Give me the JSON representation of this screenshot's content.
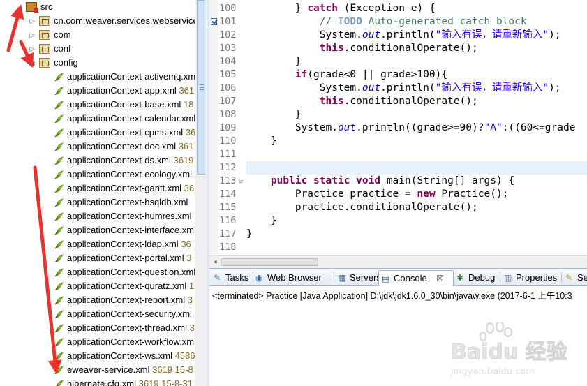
{
  "tree": {
    "root": {
      "label": "src",
      "icon": "source-folder-icon"
    },
    "items": [
      {
        "label": "cn.com.weaver.services.webservice",
        "meta": "",
        "kind": "package",
        "expanded": false
      },
      {
        "label": "com",
        "meta": "",
        "kind": "package",
        "expanded": false
      },
      {
        "label": "conf",
        "meta": "",
        "kind": "package",
        "expanded": false
      },
      {
        "label": "config",
        "meta": "",
        "kind": "package",
        "expanded": true
      }
    ],
    "files": [
      {
        "label": "applicationContext-activemq.xml",
        "meta": ""
      },
      {
        "label": "applicationContext-app.xml",
        "meta": "361"
      },
      {
        "label": "applicationContext-base.xml",
        "meta": "18"
      },
      {
        "label": "applicationContext-calendar.xml",
        "meta": ""
      },
      {
        "label": "applicationContext-cpms.xml",
        "meta": "36"
      },
      {
        "label": "applicationContext-doc.xml",
        "meta": "361"
      },
      {
        "label": "applicationContext-ds.xml",
        "meta": "3619"
      },
      {
        "label": "applicationContext-ecology.xml",
        "meta": ""
      },
      {
        "label": "applicationContext-gantt.xml",
        "meta": "36"
      },
      {
        "label": "applicationContext-hsqldb.xml",
        "meta": ""
      },
      {
        "label": "applicationContext-humres.xml",
        "meta": ""
      },
      {
        "label": "applicationContext-interface.xml",
        "meta": ""
      },
      {
        "label": "applicationContext-ldap.xml",
        "meta": "36"
      },
      {
        "label": "applicationContext-portal.xml",
        "meta": "3"
      },
      {
        "label": "applicationContext-question.xml",
        "meta": ""
      },
      {
        "label": "applicationContext-quratz.xml",
        "meta": "1"
      },
      {
        "label": "applicationContext-report.xml",
        "meta": "3"
      },
      {
        "label": "applicationContext-security.xml",
        "meta": ""
      },
      {
        "label": "applicationContext-thread.xml",
        "meta": "3"
      },
      {
        "label": "applicationContext-workflow.xml",
        "meta": ""
      },
      {
        "label": "applicationContext-ws.xml",
        "meta": "4586"
      },
      {
        "label": "eweaver-service.xml",
        "meta": "3619  15-8"
      },
      {
        "label": "hibernate.cfg.xml",
        "meta": "3619  15-8-31"
      }
    ]
  },
  "editor": {
    "lines": [
      {
        "num": "100",
        "code": "        } catch (Exception e) {"
      },
      {
        "num": "101",
        "code": "            // TODO Auto-generated catch block"
      },
      {
        "num": "102",
        "code": "            System.out.println(\"输入有误，请重新输入\");"
      },
      {
        "num": "103",
        "code": "            this.conditionalOperate();"
      },
      {
        "num": "104",
        "code": "        }"
      },
      {
        "num": "105",
        "code": "        if(grade<0 || grade>100){"
      },
      {
        "num": "106",
        "code": "            System.out.println(\"输入有误，请重新输入\");"
      },
      {
        "num": "107",
        "code": "            this.conditionalOperate();"
      },
      {
        "num": "108",
        "code": "        }"
      },
      {
        "num": "109",
        "code": "        System.out.println((grade>=90)?\"A\":((60<=grade"
      },
      {
        "num": "110",
        "code": "    }"
      },
      {
        "num": "111",
        "code": ""
      },
      {
        "num": "112",
        "code": ""
      },
      {
        "num": "113",
        "code": "    public static void main(String[] args) {"
      },
      {
        "num": "114",
        "code": "        Practice practice = new Practice();"
      },
      {
        "num": "115",
        "code": "        practice.conditionalOperate();"
      },
      {
        "num": "116",
        "code": "    }"
      },
      {
        "num": "117",
        "code": "}"
      },
      {
        "num": "118",
        "code": ""
      }
    ]
  },
  "bottom": {
    "tabs": [
      {
        "label": "Tasks",
        "icon": "tasks-icon"
      },
      {
        "label": "Web Browser",
        "icon": "globe-icon"
      },
      {
        "label": "Servers",
        "icon": "servers-icon"
      },
      {
        "label": "Console",
        "icon": "console-icon",
        "active": true,
        "close": "☒"
      },
      {
        "label": "Debug",
        "icon": "bug-icon"
      },
      {
        "label": "Properties",
        "icon": "properties-icon"
      },
      {
        "label": "Se",
        "icon": "search-icon"
      }
    ],
    "console_text": "<terminated> Practice [Java Application] D:\\jdk\\jdk1.6.0_30\\bin\\javaw.exe (2017-6-1 上午10:3"
  },
  "watermark": {
    "brand": "Baidu 经验",
    "site": "jingyan.baidu.com"
  },
  "colors": {
    "keyword": "#7f0055",
    "comment": "#3f7f5f",
    "string": "#2a00ff",
    "field": "#0000c0",
    "current_line": "#e8f2fe",
    "annotation_arrow": "#e8332c"
  }
}
